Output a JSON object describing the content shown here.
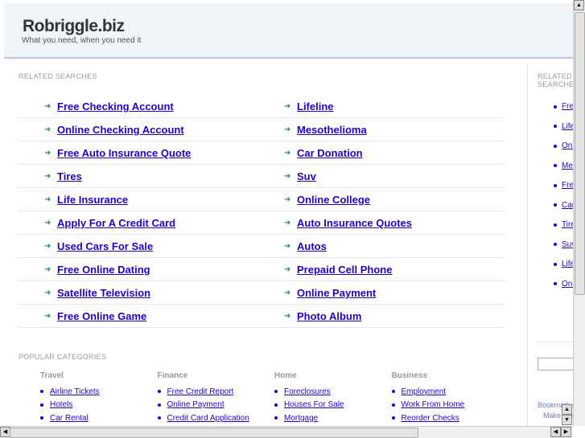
{
  "header": {
    "title": "Robriggle.biz",
    "tagline": "What you need, when you need it"
  },
  "related": {
    "heading": "RELATED SEARCHES",
    "left": [
      "Free Checking Account",
      "Online Checking Account",
      "Free Auto Insurance Quote",
      "Tires",
      "Life Insurance",
      "Apply For A Credit Card",
      "Used Cars For Sale",
      "Free Online Dating",
      "Satellite Television",
      "Free Online Game"
    ],
    "right": [
      "Lifeline",
      "Mesothelioma",
      "Car Donation",
      "Suv",
      "Online College",
      "Auto Insurance Quotes",
      "Autos",
      "Prepaid Cell Phone",
      "Online Payment",
      "Photo Album"
    ]
  },
  "sidebar": {
    "heading": "RELATED SEARCHES",
    "items": [
      "Free Checking Account",
      "Lifeline",
      "Online Checking Account",
      "Mesothelioma",
      "Free Auto Insurance Quote",
      "Car Donation",
      "Tires",
      "Suv",
      "Life Insurance",
      "Online College"
    ],
    "bookmark": "Bookmark this page",
    "homepage": "Make this your homepage"
  },
  "popular": {
    "heading": "POPULAR CATEGORIES",
    "cats": [
      {
        "title": "Travel",
        "links": [
          "Airline Tickets",
          "Hotels",
          "Car Rental"
        ]
      },
      {
        "title": "Finance",
        "links": [
          "Free Credit Report",
          "Online Payment",
          "Credit Card Application"
        ]
      },
      {
        "title": "Home",
        "links": [
          "Foreclosures",
          "Houses For Sale",
          "Mortgage"
        ]
      },
      {
        "title": "Business",
        "links": [
          "Employment",
          "Work From Home",
          "Reorder Checks"
        ]
      }
    ]
  }
}
